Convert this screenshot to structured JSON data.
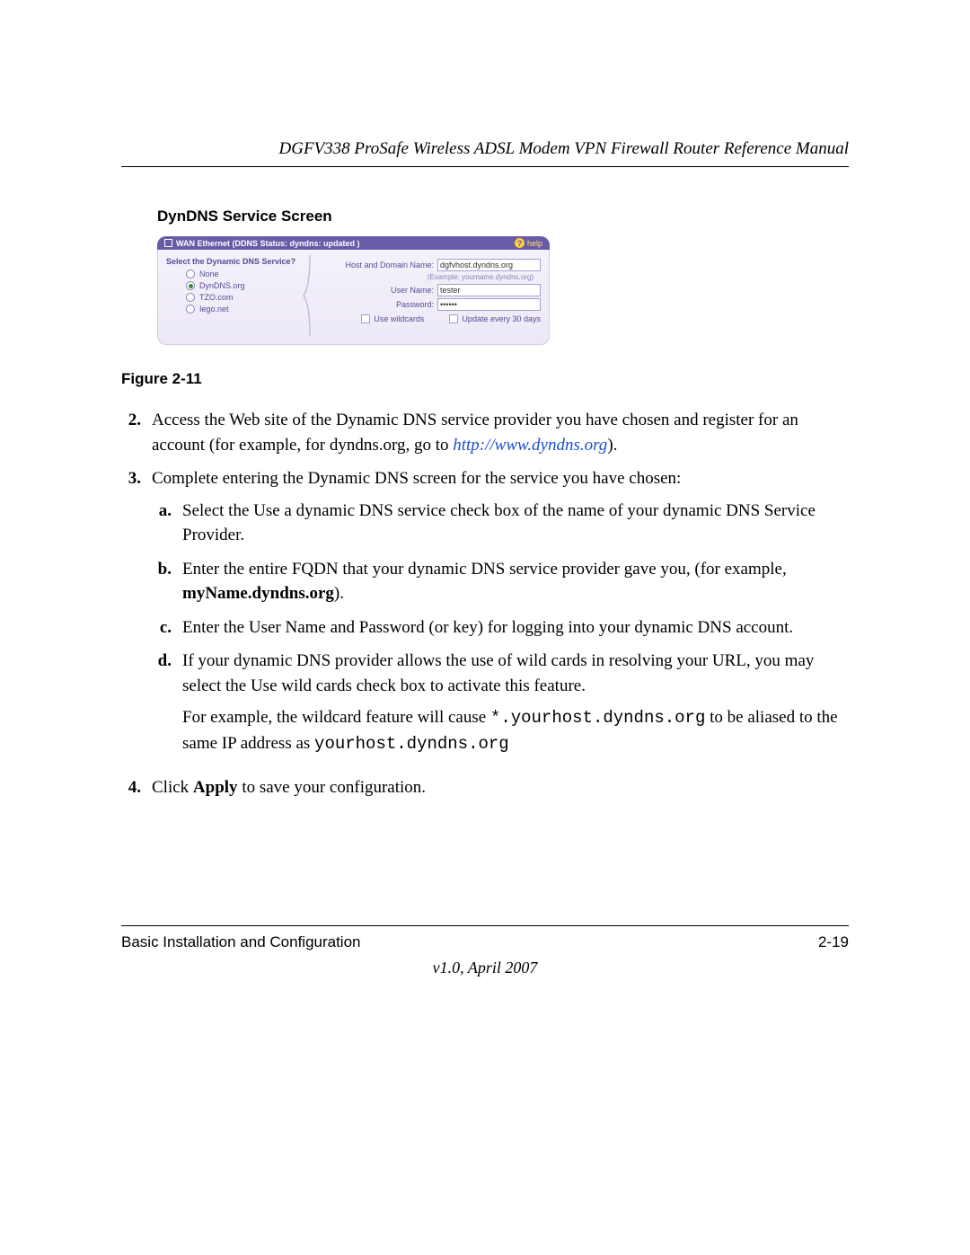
{
  "header": {
    "title": "DGFV338 ProSafe Wireless ADSL Modem VPN Firewall Router Reference Manual"
  },
  "section": {
    "heading": "DynDNS Service Screen"
  },
  "ui": {
    "titlebar": "WAN Ethernet (DDNS Status: dyndns: updated )",
    "help": "help",
    "left_title": "Select the Dynamic DNS Service?",
    "options": {
      "none": "None",
      "dyndns": "DynDNS.org",
      "tzo": "TZO.com",
      "iego": "Iego.net"
    },
    "labels": {
      "host": "Host and Domain Name:",
      "example": "(Example: yourname.dyndns.org)",
      "user": "User Name:",
      "password": "Password:",
      "wildcards": "Use wildcards",
      "update": "Update every 30 days"
    },
    "values": {
      "host": "dgfvhost.dyndns.org",
      "user": "tester",
      "password": "••••••"
    }
  },
  "figure": "Figure 2-11",
  "steps": {
    "s2": {
      "num": "2.",
      "text_a": "Access the Web site of the Dynamic DNS service provider you have chosen and register for an account (for example, for dyndns.org, go to ",
      "link": "http://www.dyndns.org",
      "text_b": ")."
    },
    "s3": {
      "num": "3.",
      "intro": "Complete entering the Dynamic DNS screen for the service you have chosen:",
      "a": {
        "letter": "a.",
        "text": "Select the Use a dynamic DNS service check box of the name of your dynamic DNS Service Provider."
      },
      "b": {
        "letter": "b.",
        "text_a": "Enter the entire FQDN that your dynamic DNS service provider gave you, (for example, ",
        "bold": "myName.dyndns.org",
        "text_b": ")."
      },
      "c": {
        "letter": "c.",
        "text": "Enter the User Name and Password (or key) for logging into your dynamic DNS account."
      },
      "d": {
        "letter": "d.",
        "text1": "If your dynamic DNS provider allows the use of wild cards in resolving your URL, you may select the Use wild cards check box to activate this feature.",
        "text2a": "For example, the wildcard feature will cause ",
        "code1": "*.yourhost.dyndns.org",
        "text2b": " to be aliased to the same IP address as ",
        "code2": "yourhost.dyndns.org"
      }
    },
    "s4": {
      "num": "4.",
      "text_a": "Click ",
      "bold": "Apply",
      "text_b": " to save your configuration."
    }
  },
  "footer": {
    "left": "Basic Installation and Configuration",
    "right": "2-19",
    "version": "v1.0, April 2007"
  }
}
